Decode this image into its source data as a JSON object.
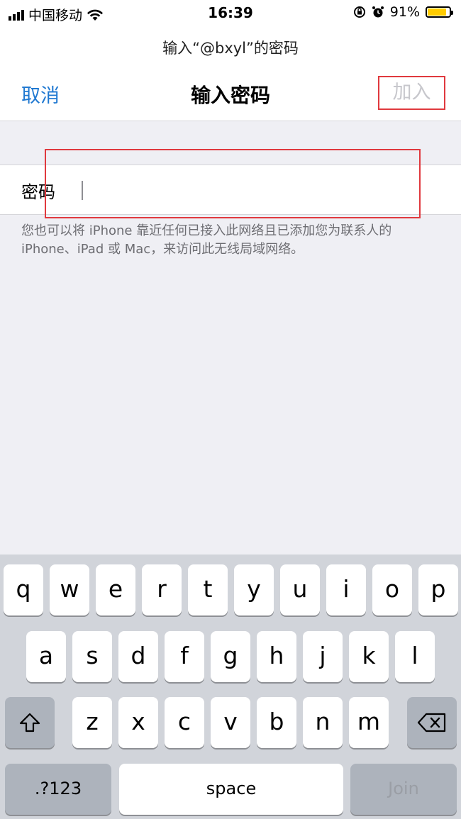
{
  "status_bar": {
    "carrier": "中国移动",
    "time": "16:39",
    "battery_percent": "91%",
    "battery_level": 0.91,
    "battery_color": "#ffcc00"
  },
  "prompt": "输入“@bxyl”的密码",
  "nav": {
    "cancel_label": "取消",
    "title": "输入密码",
    "join_label": "加入"
  },
  "password_field": {
    "label": "密码",
    "value": "",
    "placeholder": ""
  },
  "hint": "您也可以将 iPhone 靠近任何已接入此网络且已添加您为联系人的 iPhone、iPad 或 Mac，来访问此无线局域网络。",
  "keyboard": {
    "row1": [
      "q",
      "w",
      "e",
      "r",
      "t",
      "y",
      "u",
      "i",
      "o",
      "p"
    ],
    "row2": [
      "a",
      "s",
      "d",
      "f",
      "g",
      "h",
      "j",
      "k",
      "l"
    ],
    "row3": [
      "z",
      "x",
      "c",
      "v",
      "b",
      "n",
      "m"
    ],
    "shift_icon": "shift-icon",
    "delete_icon": "delete-icon",
    "numbers_label": ".?123",
    "space_label": "space",
    "join_label": "Join"
  },
  "colors": {
    "accent": "#1f78d1",
    "highlight": "#e0393e"
  }
}
